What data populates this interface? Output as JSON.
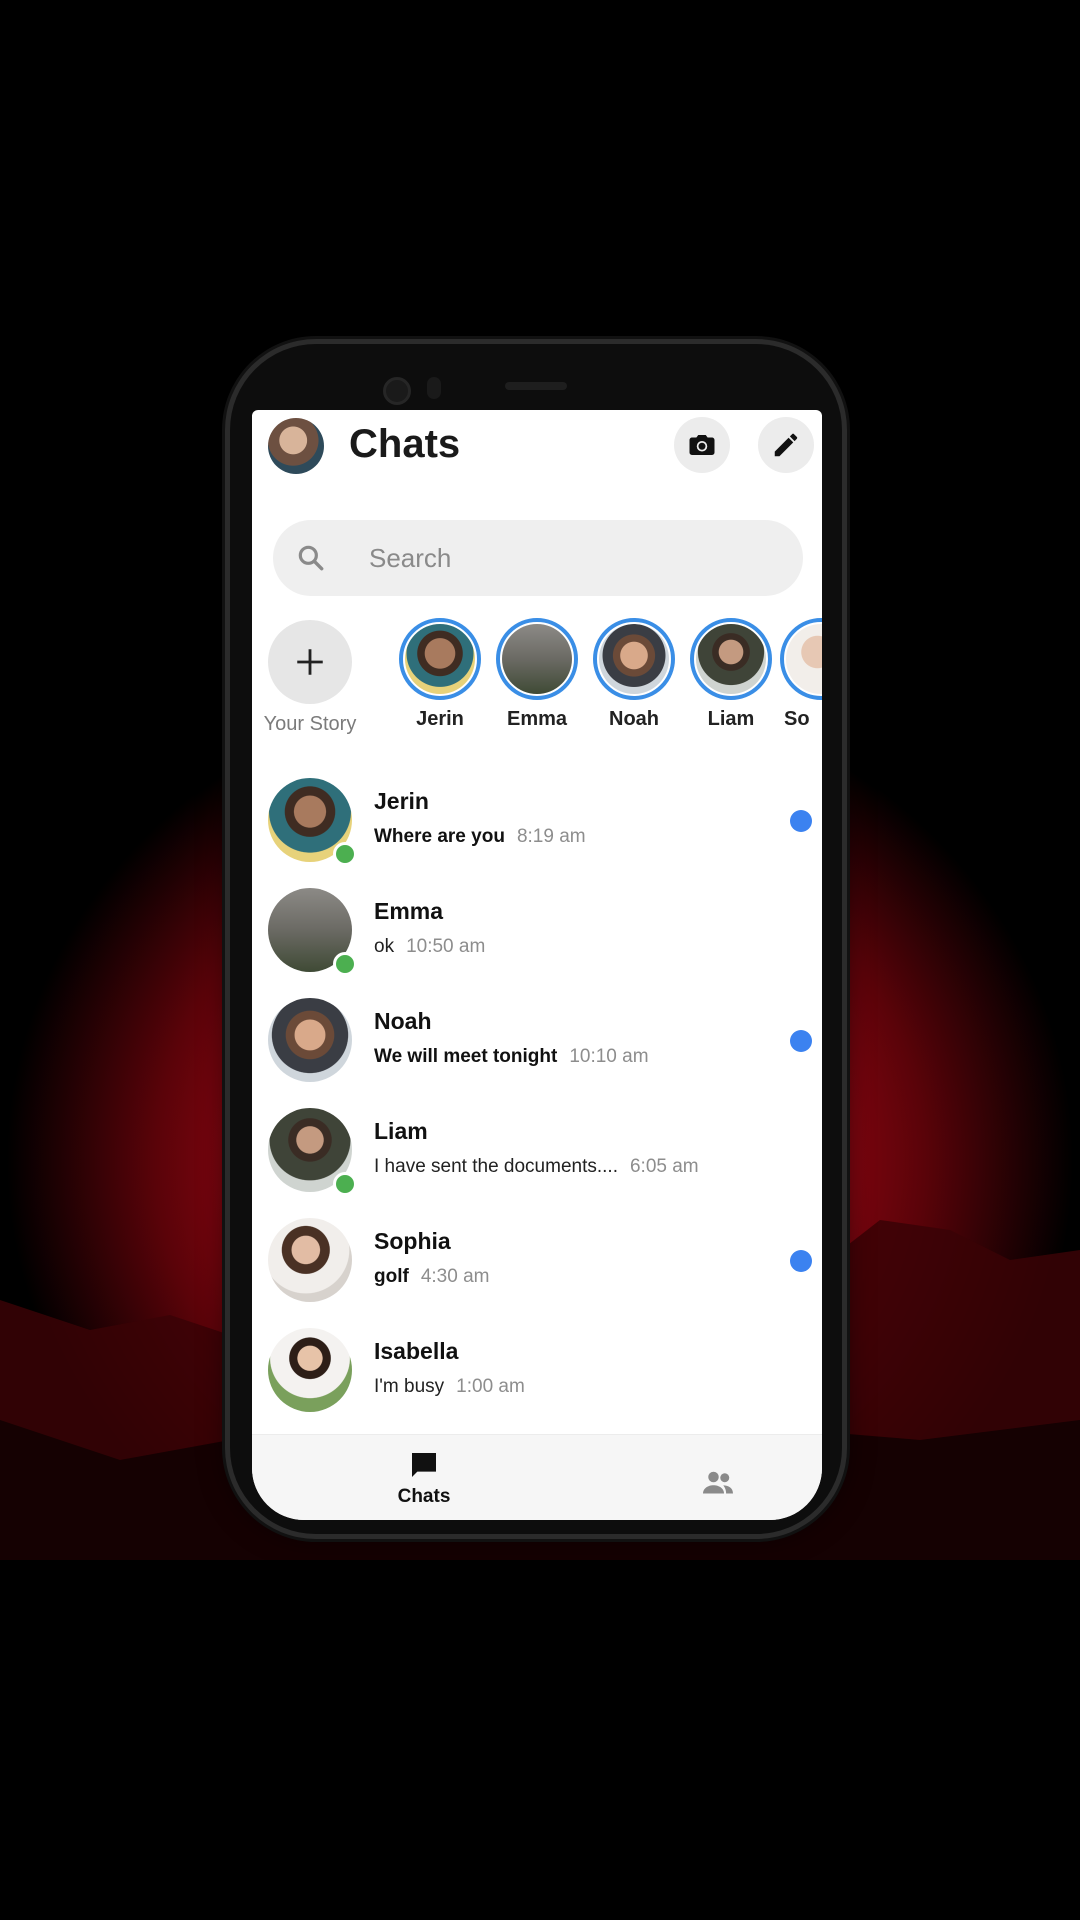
{
  "header": {
    "title": "Chats"
  },
  "search": {
    "placeholder": "Search"
  },
  "stories": {
    "add_label": "Your Story",
    "items": [
      {
        "name": "Jerin"
      },
      {
        "name": "Emma"
      },
      {
        "name": "Noah"
      },
      {
        "name": "Liam"
      },
      {
        "name": "So"
      }
    ]
  },
  "chats": [
    {
      "name": "Jerin",
      "message": "Where are you",
      "time": "8:19 am",
      "unread": true,
      "online": true
    },
    {
      "name": "Emma",
      "message": "ok",
      "time": "10:50 am",
      "unread": false,
      "online": true
    },
    {
      "name": "Noah",
      "message": "We will meet tonight",
      "time": "10:10 am",
      "unread": true,
      "online": false
    },
    {
      "name": "Liam",
      "message": "I have sent the documents....",
      "time": "6:05 am",
      "unread": false,
      "online": true
    },
    {
      "name": "Sophia",
      "message": "golf",
      "time": "4:30 am",
      "unread": true,
      "online": false
    },
    {
      "name": "Isabella",
      "message": "I'm busy",
      "time": "1:00 am",
      "unread": false,
      "online": false
    }
  ],
  "bottom_nav": {
    "chats_label": "Chats"
  },
  "colors": {
    "accent": "#3b82f0",
    "story_ring": "#3a8ee6",
    "online": "#4caf50",
    "background_glow": "#d3081c"
  },
  "icons": [
    "camera-icon",
    "pencil-icon",
    "search-icon",
    "plus-icon",
    "chat-bubble-icon",
    "people-icon"
  ]
}
